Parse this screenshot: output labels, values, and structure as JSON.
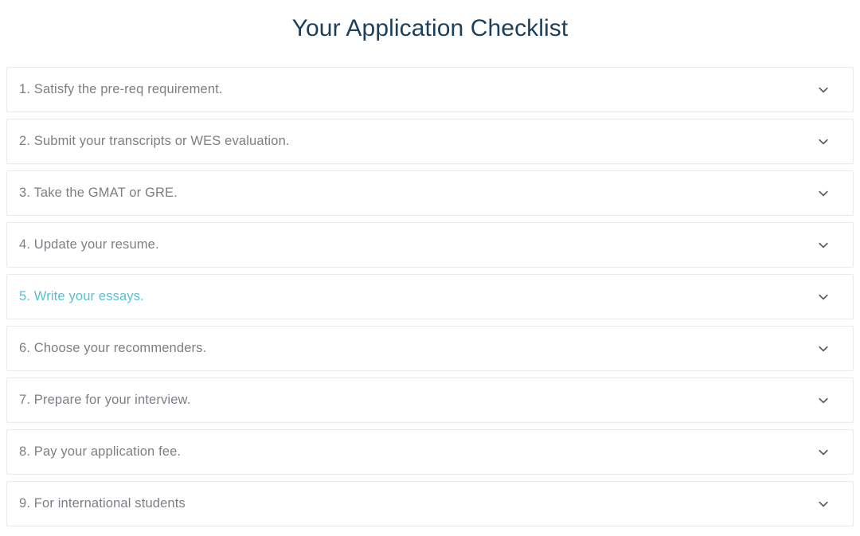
{
  "page": {
    "title": "Your Application Checklist",
    "title_color": "#1d3f5c",
    "background_color": "#ffffff"
  },
  "theme": {
    "item_text_color": "#7b7f84",
    "active_item_text_color": "#59bfd3",
    "item_border_color": "#e9eaec",
    "chevron_color": "#565a5e"
  },
  "accordion": {
    "expand_icon": "chevron-down-icon",
    "items": [
      {
        "label": "1. Satisfy the pre-req requirement.",
        "active": false,
        "expanded": false
      },
      {
        "label": "2. Submit your transcripts or WES evaluation.",
        "active": false,
        "expanded": false
      },
      {
        "label": "3. Take the GMAT or GRE.",
        "active": false,
        "expanded": false
      },
      {
        "label": "4. Update your resume.",
        "active": false,
        "expanded": false
      },
      {
        "label": "5. Write your essays.",
        "active": true,
        "expanded": false
      },
      {
        "label": "6. Choose your recommenders.",
        "active": false,
        "expanded": false
      },
      {
        "label": "7. Prepare for your interview.",
        "active": false,
        "expanded": false
      },
      {
        "label": "8. Pay your application fee.",
        "active": false,
        "expanded": false
      },
      {
        "label": "9. For international students",
        "active": false,
        "expanded": false
      }
    ]
  }
}
